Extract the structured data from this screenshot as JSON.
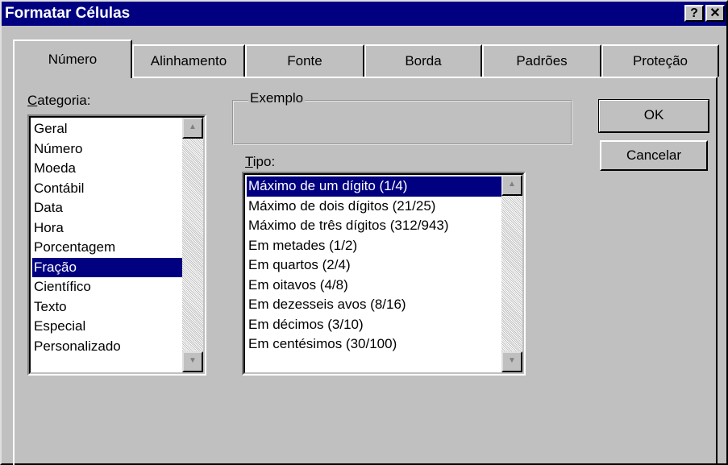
{
  "window": {
    "title": "Formatar Células",
    "help_label": "?",
    "close_label": "✕"
  },
  "tabs": [
    {
      "label": "Número",
      "active": true
    },
    {
      "label": "Alinhamento"
    },
    {
      "label": "Fonte"
    },
    {
      "label": "Borda"
    },
    {
      "label": "Padrões"
    },
    {
      "label": "Proteção"
    }
  ],
  "category": {
    "label_first": "C",
    "label_rest": "ategoria:",
    "items": [
      "Geral",
      "Número",
      "Moeda",
      "Contábil",
      "Data",
      "Hora",
      "Porcentagem",
      "Fração",
      "Científico",
      "Texto",
      "Especial",
      "Personalizado"
    ],
    "selected": "Fração"
  },
  "example": {
    "label": "Exemplo"
  },
  "type": {
    "label_first": "T",
    "label_rest": "ipo:",
    "items": [
      "Máximo de um dígito (1/4)",
      "Máximo de dois dígitos (21/25)",
      "Máximo de três dígitos (312/943)",
      "Em metades (1/2)",
      "Em quartos (2/4)",
      "Em oitavos (4/8)",
      "Em dezesseis avos (8/16)",
      "Em décimos (3/10)",
      "Em centésimos (30/100)"
    ],
    "selected": "Máximo de um dígito (1/4)"
  },
  "buttons": {
    "ok": "OK",
    "cancel": "Cancelar"
  },
  "icons": {
    "scroll_up": "▲",
    "scroll_down": "▼"
  }
}
